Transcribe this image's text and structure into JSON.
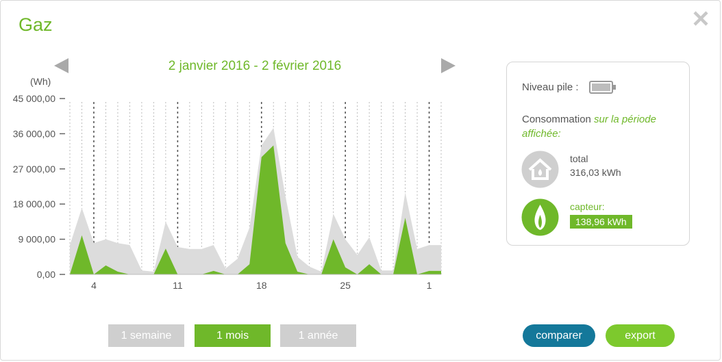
{
  "modal": {
    "title": "Gaz",
    "close_icon": "close-x-icon"
  },
  "period": {
    "label": "2 janvier 2016 - 2 février 2016",
    "prev_icon": "triangle-left-icon",
    "next_icon": "triangle-right-icon"
  },
  "chart_data": {
    "type": "area",
    "ylabel": "(Wh)",
    "yticks": [
      "45 000,00",
      "36 000,00",
      "27 000,00",
      "18 000,00",
      "9 000,00",
      "0,00"
    ],
    "ytick_values": [
      45000,
      36000,
      27000,
      18000,
      9000,
      0
    ],
    "ylim": [
      0,
      45000
    ],
    "xticks": [
      {
        "day": 4,
        "label": "4"
      },
      {
        "day": 11,
        "label": "11"
      },
      {
        "day": 18,
        "label": "18"
      },
      {
        "day": 25,
        "label": "25"
      },
      {
        "day": 32,
        "label": "1"
      }
    ],
    "x_day_range": [
      2,
      33
    ],
    "x_days": [
      2,
      3,
      4,
      5,
      6,
      7,
      8,
      9,
      10,
      11,
      12,
      13,
      14,
      15,
      16,
      17,
      18,
      19,
      20,
      21,
      22,
      23,
      24,
      25,
      26,
      27,
      28,
      29,
      30,
      31,
      32,
      33
    ],
    "series": [
      {
        "color": "#dcdcdc",
        "values": [
          7500,
          17000,
          8000,
          9000,
          8000,
          7500,
          1000,
          700,
          13500,
          7000,
          6500,
          6500,
          7500,
          1500,
          4000,
          12000,
          33000,
          37500,
          20000,
          4500,
          2000,
          700,
          15500,
          9000,
          5000,
          9500,
          1000,
          1000,
          21000,
          6500,
          7500,
          7500
        ]
      },
      {
        "color": "#6fb82a",
        "values": [
          0,
          10000,
          0,
          2300,
          700,
          0,
          0,
          0,
          6600,
          0,
          0,
          0,
          900,
          0,
          0,
          2600,
          30000,
          33000,
          8000,
          700,
          0,
          0,
          9000,
          1800,
          0,
          2600,
          0,
          0,
          14500,
          0,
          900,
          900
        ]
      }
    ],
    "grid": true
  },
  "info": {
    "battery_label": "Niveau pile :",
    "battery_icon": "battery-icon",
    "consumption_prefix": "Consommation ",
    "consumption_emphasis": "sur la période affichée",
    "consumption_suffix": ":",
    "total_icon": "house-icon",
    "total_label": "total",
    "total_value": "316,03 kWh",
    "sensor_icon": "flame-icon",
    "sensor_label": "capteur:",
    "sensor_value": "138,96 kWh"
  },
  "range_buttons": [
    {
      "label": "1 semaine",
      "active": false
    },
    {
      "label": "1 mois",
      "active": true
    },
    {
      "label": "1 année",
      "active": false
    }
  ],
  "actions": {
    "compare_label": "comparer",
    "export_label": "export"
  },
  "colors": {
    "accent": "#6fb82a",
    "grey_series": "#dcdcdc",
    "compare_button": "#14789a",
    "export_button": "#7dc92d",
    "inactive_button": "#cfcfcf"
  }
}
